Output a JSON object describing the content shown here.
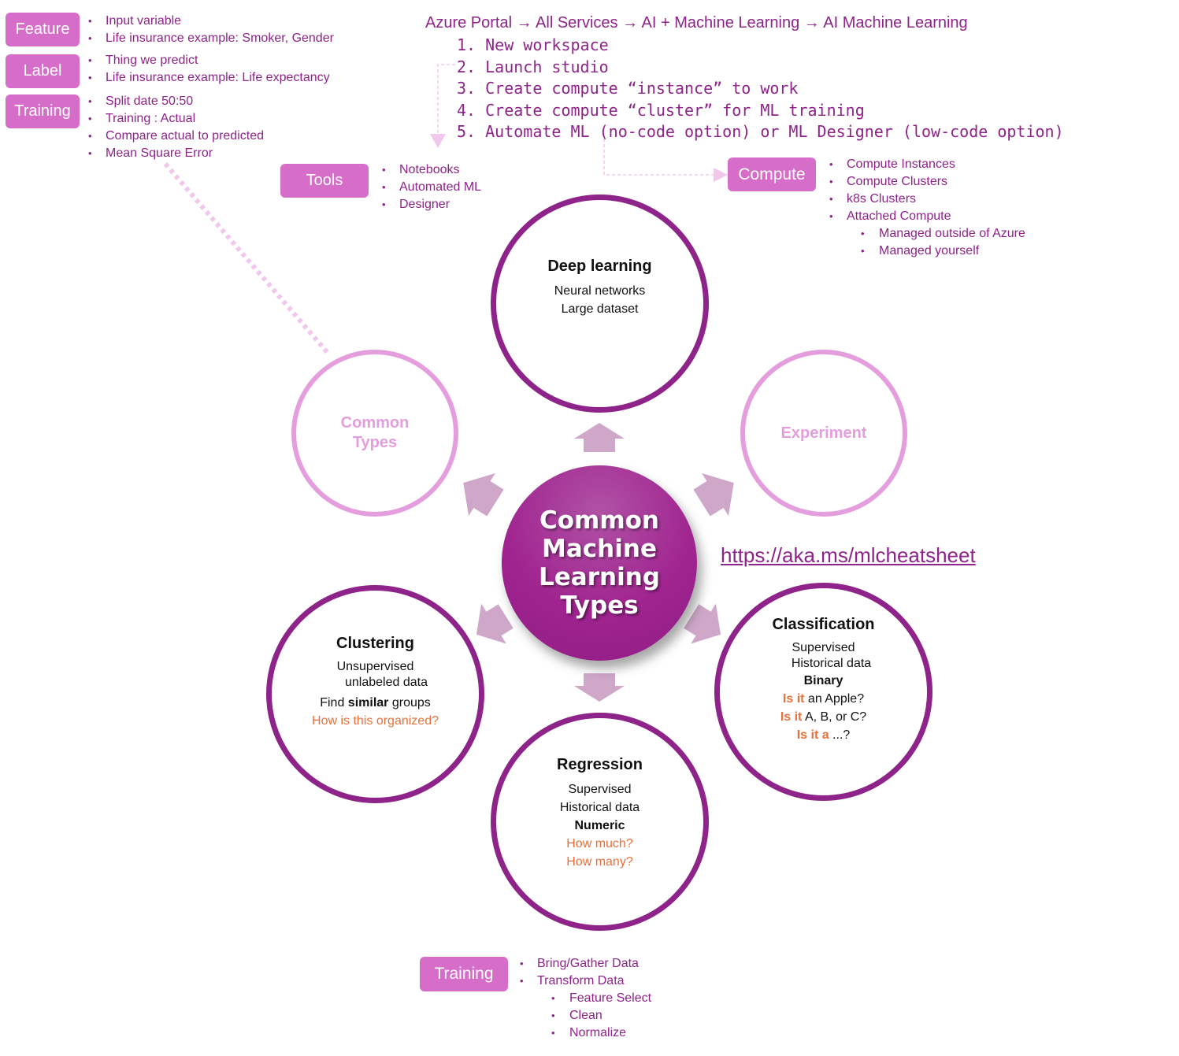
{
  "left_panel": {
    "feature": {
      "label": "Feature",
      "bullets": [
        "Input variable",
        "Life insurance example: Smoker, Gender"
      ]
    },
    "label": {
      "label": "Label",
      "bullets": [
        "Thing we predict",
        "Life insurance example: Life expectancy"
      ]
    },
    "training": {
      "label": "Training",
      "bullets": [
        "Split date 50:50",
        "Training : Actual",
        "Compare actual to predicted",
        "Mean Square Error"
      ]
    }
  },
  "azure": {
    "breadcrumb": "Azure Portal → All Services → AI + Machine Learning → AI Machine Learning",
    "steps": [
      "1. New workspace",
      "2. Launch studio",
      "3. Create compute “instance” to work",
      "4. Create compute “cluster” for ML training",
      "5. Automate ML (no-code option) or ML Designer (low-code option)"
    ]
  },
  "tools": {
    "label": "Tools",
    "bullets": [
      "Notebooks",
      "Automated ML",
      "Designer"
    ]
  },
  "compute": {
    "label": "Compute",
    "bullets": [
      "Compute Instances",
      "Compute Clusters",
      "k8s Clusters",
      "Attached Compute"
    ],
    "sub_bullets": [
      "Managed outside of Azure",
      "Managed yourself"
    ]
  },
  "hub": {
    "lines": [
      "Common",
      "Machine",
      "Learning",
      "Types"
    ]
  },
  "circles": {
    "deep_learning": {
      "title": "Deep learning",
      "lines": [
        "Neural networks",
        "Large dataset"
      ]
    },
    "common_types": {
      "lines": [
        "Common",
        "Types"
      ]
    },
    "experiment": {
      "title": "Experiment"
    },
    "clustering": {
      "title": "Clustering",
      "line1": "Unsupervised",
      "line2": "unlabeled data",
      "line3_pre": "Find ",
      "line3_bold": "similar",
      "line3_post": " groups",
      "question": "How is this organized?"
    },
    "classification": {
      "title": "Classification",
      "line1": "Supervised",
      "line2": "Historical data",
      "line3": "Binary",
      "q1_hl": "Is it",
      "q1_rest": " an Apple?",
      "q2_hl": "Is it",
      "q2_rest": " A, B, or C?",
      "q3_hl": "Is it a",
      "q3_rest": " ...?"
    },
    "regression": {
      "title": "Regression",
      "line1": "Supervised",
      "line2": "Historical data",
      "line3": "Numeric",
      "q1": "How much?",
      "q2": "How many?"
    }
  },
  "link": {
    "text": "https://aka.ms/mlcheatsheet"
  },
  "bottom_training": {
    "label": "Training",
    "bullets": [
      "Bring/Gather Data",
      "Transform Data"
    ],
    "sub_bullets": [
      "Feature Select",
      "Clean",
      "Normalize"
    ]
  },
  "colors": {
    "accent": "#8e2389",
    "pill": "#d66dc8",
    "light_ring": "#e49ede",
    "arrow": "#cfa8c9",
    "highlight": "#e8703a"
  }
}
